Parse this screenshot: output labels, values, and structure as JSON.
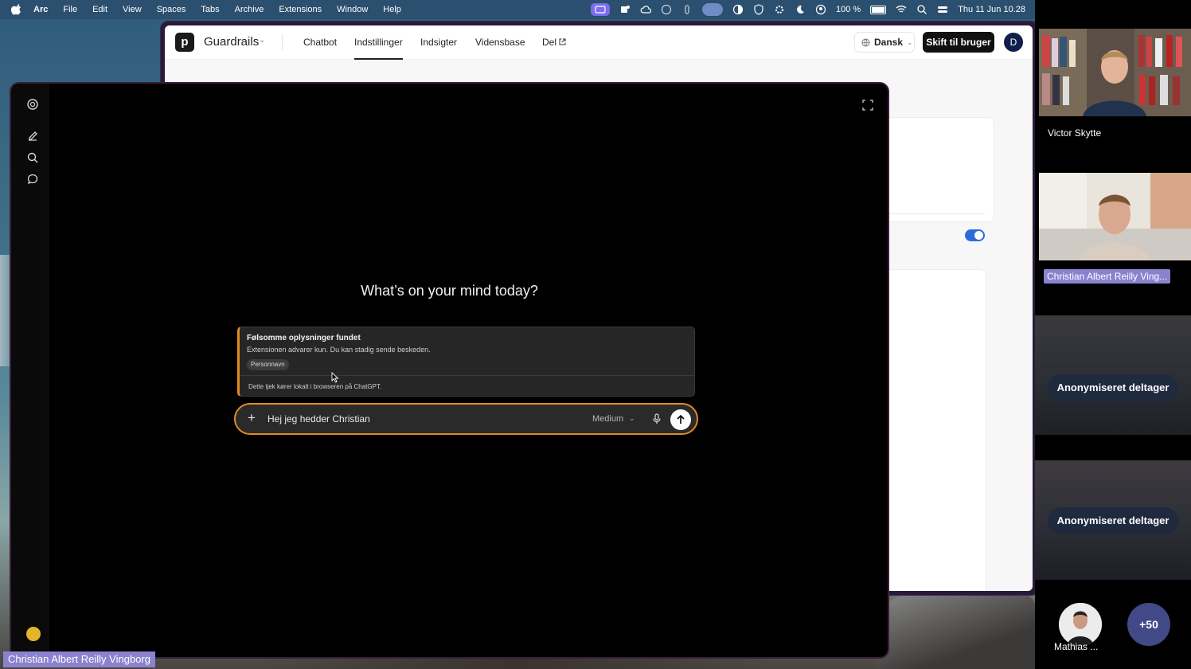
{
  "menubar": {
    "app": "Arc",
    "items": [
      "File",
      "Edit",
      "View",
      "Spaces",
      "Tabs",
      "Archive",
      "Extensions",
      "Window",
      "Help"
    ],
    "battery": "100 %",
    "datetime": "Thu 11 Jun  10.28"
  },
  "guardrails": {
    "logo_letter": "p",
    "app_name": "Guardrails",
    "nav": [
      "Chatbot",
      "Indstillinger",
      "Indsigter",
      "Vidensbase",
      "Del"
    ],
    "active_nav": "Indstillinger",
    "language": "Dansk",
    "switch_button": "Skift til bruger",
    "avatar_letter": "D",
    "toggle_on": true
  },
  "chatgpt": {
    "heading": "What’s on your mind today?",
    "warning": {
      "title": "Følsomme oplysninger fundet",
      "subtitle": "Extensionen advarer kun. Du kan stadig sende beskeden.",
      "tag": "Personnavn",
      "footer": "Dette tjek kører lokalt i browseren på ChatGPT.",
      "accent_color": "#e08a22"
    },
    "composer": {
      "value": "Hej jeg hedder Christian",
      "model": "Medium"
    }
  },
  "self_label": "Christian Albert Reilly Vingborg",
  "participants": {
    "victor": "Victor Skytte",
    "christian": "Christian Albert Reilly Ving...",
    "anon1": "Anonymiseret deltager",
    "anon2": "Anonymiseret deltager",
    "mathias": "Mathias ...",
    "more": "+50"
  }
}
